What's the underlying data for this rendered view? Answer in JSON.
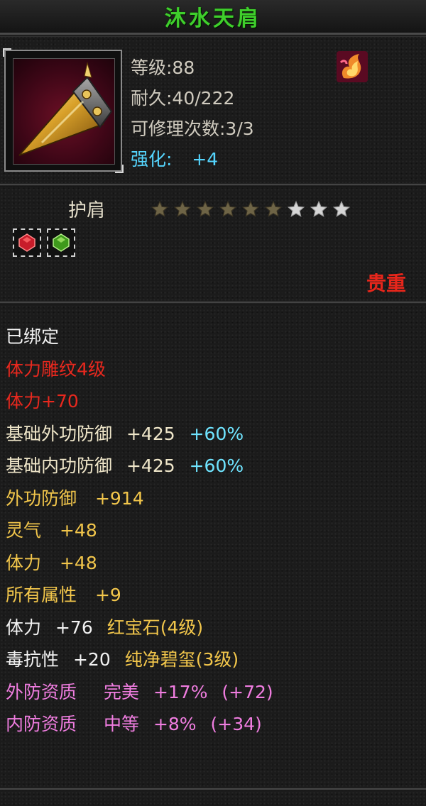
{
  "title": "沐水天肩",
  "item": {
    "icon": "golden-spiked-shoulder-icon",
    "level": "等级:88",
    "durability": "耐久:40/222",
    "repairs": "可修理次数:3/3",
    "enhance_label": "强化:",
    "enhance_value": "+4",
    "badge_icon": "flame-emblem-icon"
  },
  "part": {
    "name": "护肩",
    "stars_filled": 6,
    "stars_total": 9
  },
  "gems": [
    {
      "icon": "red-gem-icon",
      "color": "#d8202a"
    },
    {
      "icon": "green-gem-icon",
      "color": "#52b82a"
    }
  ],
  "quality": "贵重",
  "attributes": {
    "bound": "已绑定",
    "engrave": "体力雕纹4级",
    "stamina_bonus": "体力+70",
    "base_outer_def": {
      "label": "基础外功防御",
      "value": "+425",
      "pct": "+60%"
    },
    "base_inner_def": {
      "label": "基础内功防御",
      "value": "+425",
      "pct": "+60%"
    },
    "outer_def": {
      "label": "外功防御",
      "value": "+914"
    },
    "spirit": {
      "label": "灵气",
      "value": "+48"
    },
    "stamina": {
      "label": "体力",
      "value": "+48"
    },
    "all_attr": {
      "label": "所有属性",
      "value": "+9"
    },
    "gem1": {
      "label": "体力",
      "value": "+76",
      "gem": "红宝石(4级)"
    },
    "gem2": {
      "label": "毒抗性",
      "value": "+20",
      "gem": "纯净碧玺(3级)"
    },
    "outer_quality": {
      "label": "外防资质",
      "grade": "完美",
      "pct": "+17%",
      "extra": "(+72)"
    },
    "inner_quality": {
      "label": "内防资质",
      "grade": "中等",
      "pct": "+8%",
      "extra": "(+34)"
    }
  },
  "colors": {
    "title": "#3fcf2c",
    "enhance": "#55d6ff",
    "quality": "#e8261b",
    "attr_gold": "#f2c64b",
    "attr_pink": "#f07de0",
    "attr_red": "#e8281e",
    "attr_cyan": "#6fe4ff"
  }
}
